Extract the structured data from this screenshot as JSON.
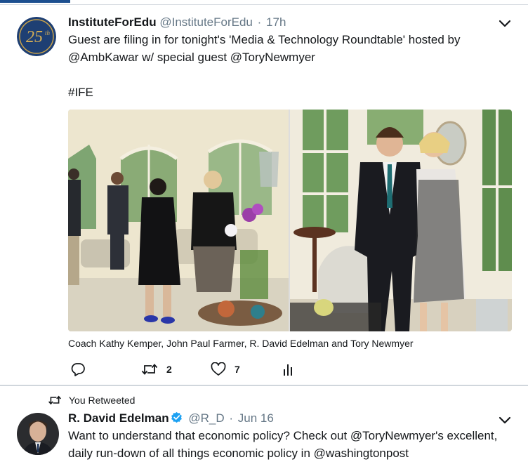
{
  "tweet1": {
    "display_name": "InstituteForEdu",
    "handle": "@InstituteForEdu",
    "separator": "·",
    "time": "17h",
    "text_line1": "Guest are filing in for tonight's 'Media & Technology Roundtable' hosted by",
    "text_line2": "@AmbKawar w/ special guest @ToryNewmyer",
    "hashtag": "#IFE",
    "avatar_text": "25th",
    "caption": "Coach Kathy Kemper, John Paul Farmer, R. David Edelman and Tory Newmyer",
    "retweet_count": "2",
    "like_count": "7"
  },
  "tweet2": {
    "retweet_note": "You Retweeted",
    "display_name": "R. David Edelman",
    "handle": "@R_D",
    "separator": "·",
    "time": "Jun 16",
    "text_line1": "Want to understand that economic policy? Check out @ToryNewmyer's excellent,",
    "text_line2": "daily run-down of all things economic policy in @washingtonpost"
  },
  "icons": {
    "reply": "reply-icon",
    "retweet": "retweet-icon",
    "like": "heart-icon",
    "analytics": "analytics-icon",
    "more": "chevron-down-icon",
    "verified": "verified-badge-icon"
  },
  "colors": {
    "accent": "#1d4f8f",
    "verified": "#1da1f2",
    "text": "#14171a",
    "muted": "#657786"
  }
}
